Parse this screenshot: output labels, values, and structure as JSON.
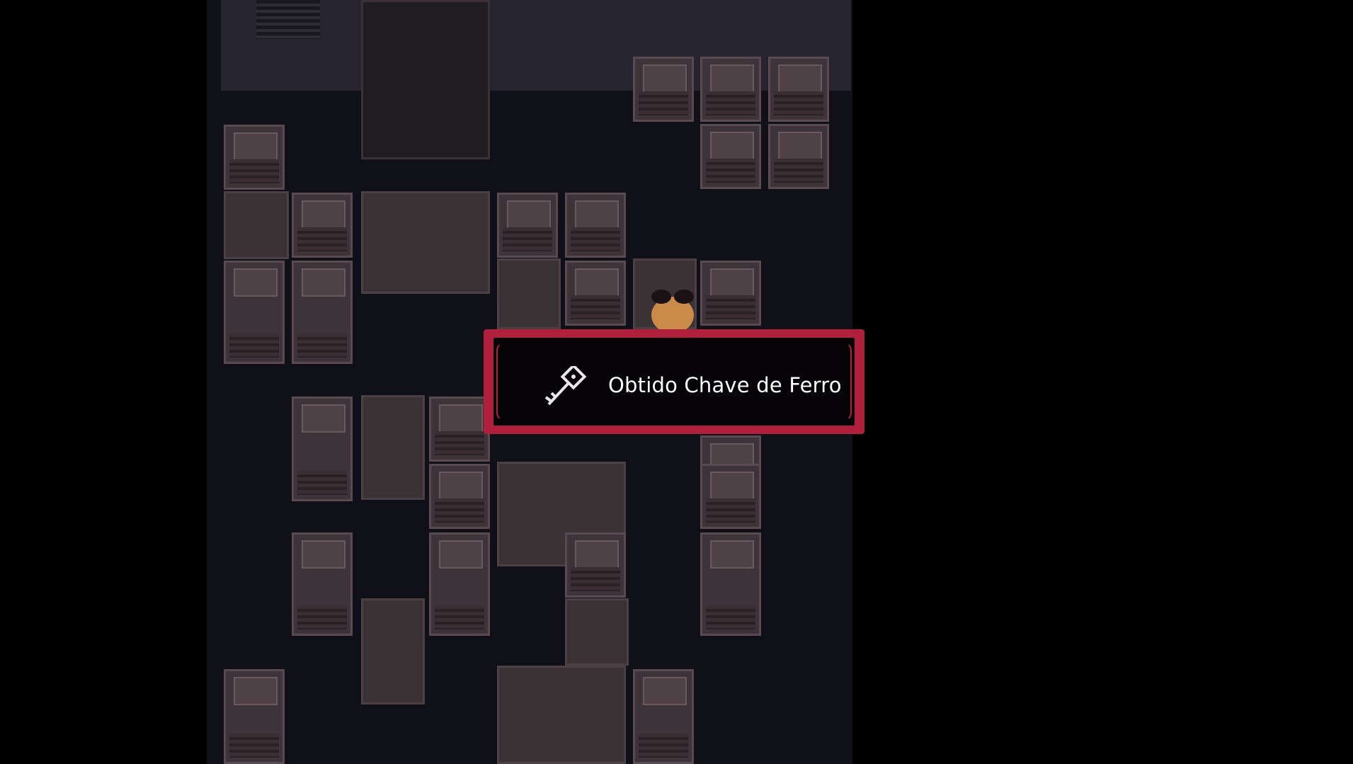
{
  "notification": {
    "text": "Obtido Chave de Ferro",
    "icon": "key-icon"
  },
  "colors": {
    "frame_accent": "#b0203c",
    "box_background": "#060406",
    "text": "#ffffff"
  }
}
